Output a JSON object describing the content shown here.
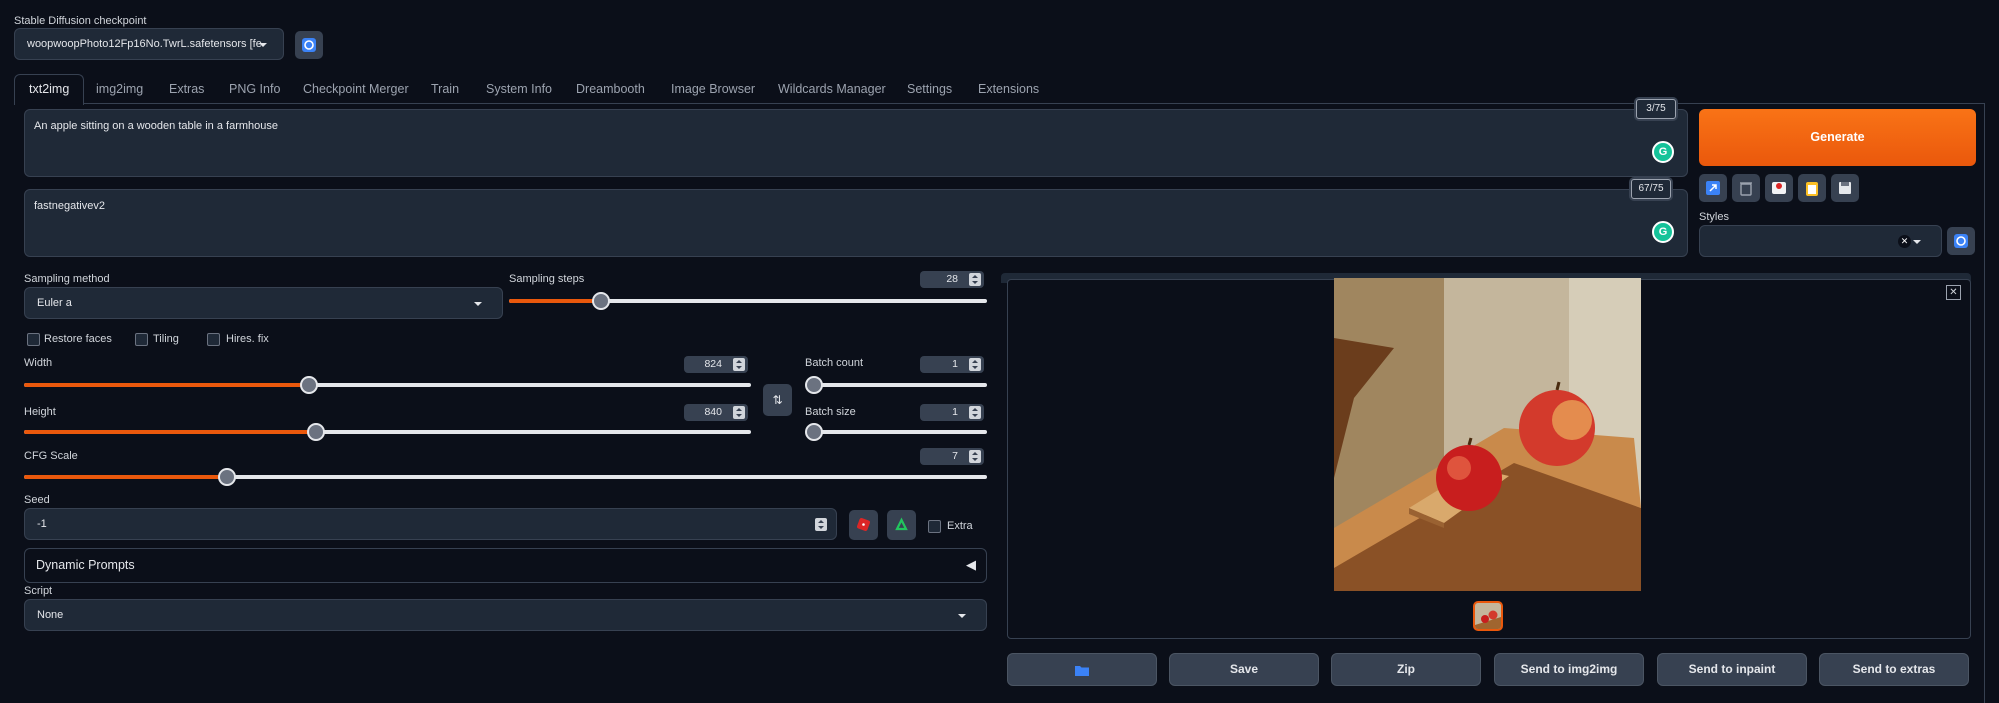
{
  "checkpoint": {
    "label": "Stable Diffusion checkpoint",
    "value": "woopwoopPhoto12Fp16No.TwrL.safetensors [fe"
  },
  "tabs": [
    "txt2img",
    "img2img",
    "Extras",
    "PNG Info",
    "Checkpoint Merger",
    "Train",
    "System Info",
    "Dreambooth",
    "Image Browser",
    "Wildcards Manager",
    "Settings",
    "Extensions"
  ],
  "prompt": {
    "text": "An apple sitting on a wooden table in a farmhouse",
    "tokens": "3/75"
  },
  "negative_prompt": {
    "text": "fastnegativev2",
    "tokens": "67/75"
  },
  "generate_label": "Generate",
  "styles_label": "Styles",
  "sampling": {
    "method_label": "Sampling method",
    "method": "Euler a",
    "steps_label": "Sampling steps",
    "steps": "28",
    "steps_fraction": 0.19
  },
  "options": {
    "restore_faces": "Restore faces",
    "tiling": "Tiling",
    "hires": "Hires. fix"
  },
  "width": {
    "label": "Width",
    "value": "824",
    "fraction": 0.39
  },
  "height": {
    "label": "Height",
    "value": "840",
    "fraction": 0.4
  },
  "batch_count": {
    "label": "Batch count",
    "value": "1",
    "fraction": 0.0
  },
  "batch_size": {
    "label": "Batch size",
    "value": "1",
    "fraction": 0.0
  },
  "cfg": {
    "label": "CFG Scale",
    "value": "7",
    "fraction": 0.21
  },
  "seed": {
    "label": "Seed",
    "value": "-1",
    "extra_label": "Extra"
  },
  "dynamic_prompts": {
    "label": "Dynamic Prompts",
    "arrow": "◀"
  },
  "script": {
    "label": "Script",
    "value": "None"
  },
  "bottom_buttons": {
    "save": "Save",
    "zip": "Zip",
    "img2img": "Send to img2img",
    "inpaint": "Send to inpaint",
    "extras": "Send to extras"
  },
  "colors": {
    "accent": "#ea580c",
    "background": "#0b0f19",
    "panel": "#1f2937",
    "border": "#374151"
  }
}
